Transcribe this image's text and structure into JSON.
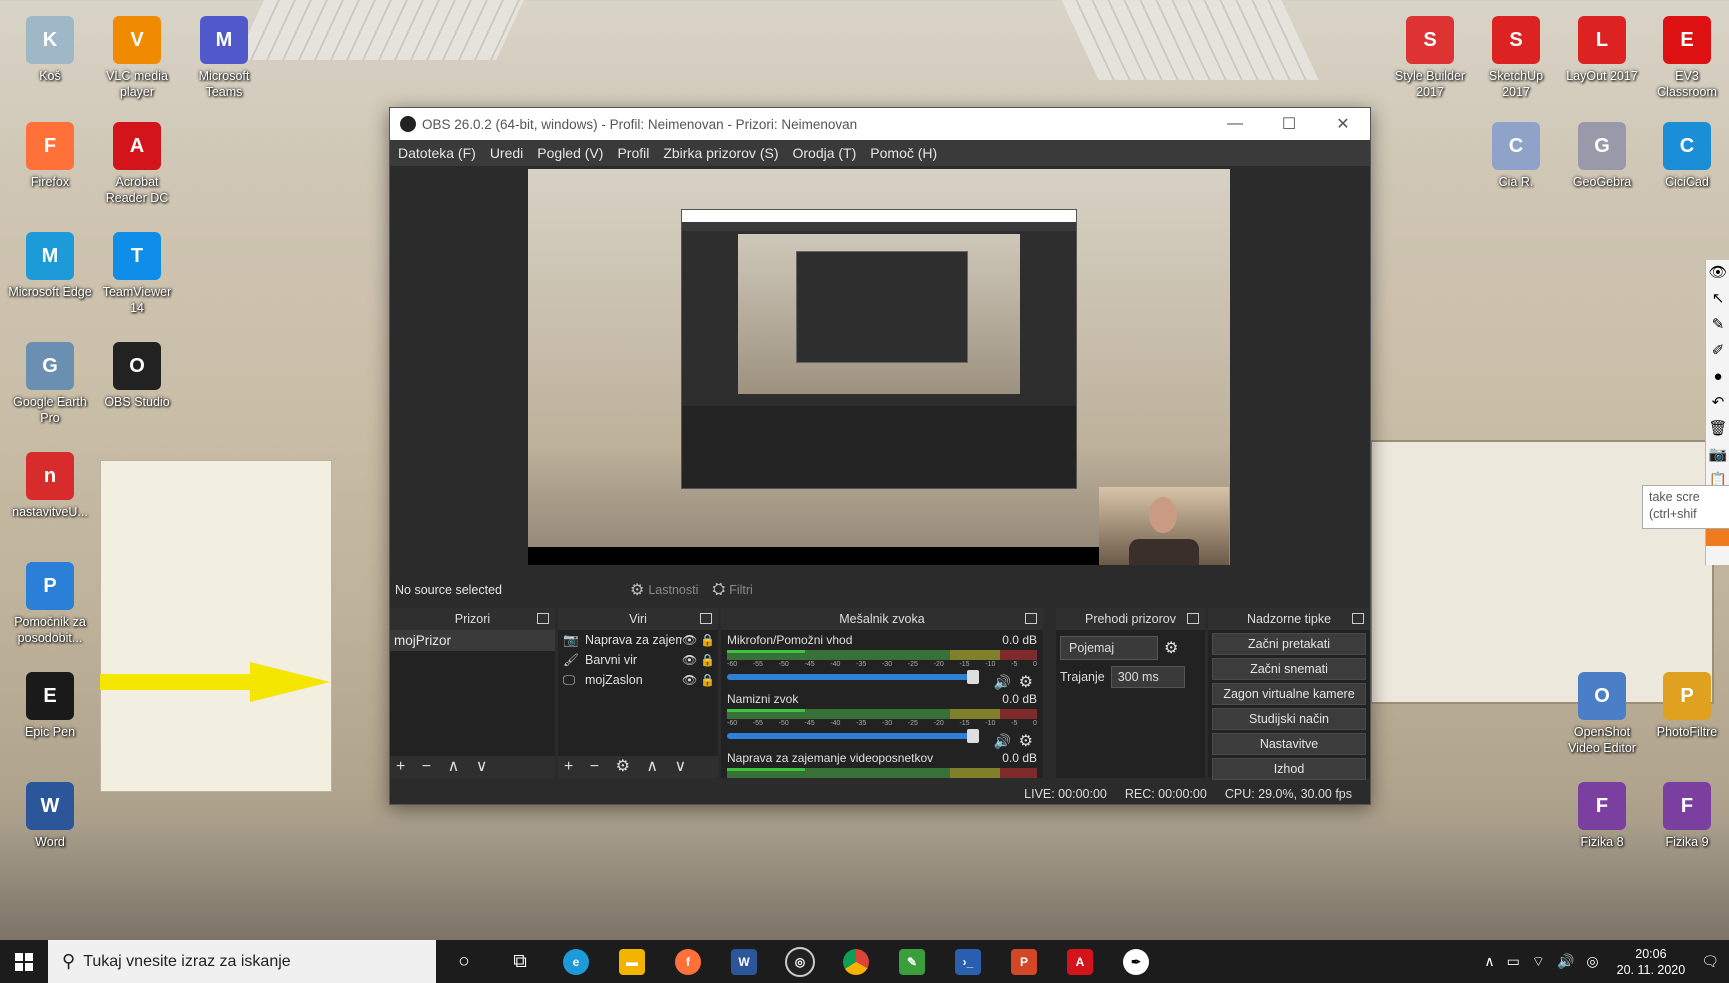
{
  "desktop": {
    "icons_left": [
      {
        "label": "Koš",
        "icon": "recycle-bin-icon",
        "color": "#9fb8c8"
      },
      {
        "label": "VLC media player",
        "icon": "vlc-icon",
        "color": "#f08a00"
      },
      {
        "label": "Microsoft Teams",
        "icon": "teams-icon",
        "color": "#5059c9"
      },
      {
        "label": "Firefox",
        "icon": "firefox-icon",
        "color": "#ff7139"
      },
      {
        "label": "Acrobat Reader DC",
        "icon": "acrobat-icon",
        "color": "#d4141b"
      },
      {
        "label": "Microsoft Edge",
        "icon": "edge-icon",
        "color": "#1c9bd8"
      },
      {
        "label": "TeamViewer 14",
        "icon": "teamviewer-icon",
        "color": "#0e8ee9"
      },
      {
        "label": "Google Earth Pro",
        "icon": "google-earth-icon",
        "color": "#6b8fb0"
      },
      {
        "label": "OBS Studio",
        "icon": "obs-icon",
        "color": "#222222"
      },
      {
        "label": "nastavitveU...",
        "icon": "toolbox-icon",
        "color": "#d82c2c"
      },
      {
        "label": "Pomočnik za posodobit...",
        "icon": "windows-update-icon",
        "color": "#2a7fd6"
      },
      {
        "label": "Epic Pen",
        "icon": "epic-pen-icon",
        "color": "#1a1a1a"
      },
      {
        "label": "Word",
        "icon": "word-icon",
        "color": "#2b579a"
      }
    ],
    "icons_right": [
      {
        "label": "Style Builder 2017",
        "icon": "style-builder-icon",
        "color": "#d33"
      },
      {
        "label": "SketchUp 2017",
        "icon": "sketchup-icon",
        "color": "#d22"
      },
      {
        "label": "LayOut 2017",
        "icon": "layout-icon",
        "color": "#d22"
      },
      {
        "label": "EV3 Classroom",
        "icon": "ev3-icon",
        "color": "#d11"
      },
      {
        "label": "Cia R.",
        "icon": "shell-icon",
        "color": "#8fa3c8"
      },
      {
        "label": "GeoGebra",
        "icon": "geogebra-icon",
        "color": "#99a"
      },
      {
        "label": "CiciCad",
        "icon": "cicicad-icon",
        "color": "#1a8fd8"
      },
      {
        "label": "OpenShot Video Editor",
        "icon": "openshot-icon",
        "color": "#4a7fc8"
      },
      {
        "label": "PhotoFiltre",
        "icon": "photofiltre-icon",
        "color": "#e0a020"
      },
      {
        "label": "Fizika 8",
        "icon": "firefox-doc-icon",
        "color": "#7b3fa0"
      },
      {
        "label": "Fizika 9",
        "icon": "firefox-doc-icon",
        "color": "#7b3fa0"
      }
    ],
    "tooltip": {
      "line1": "take scre",
      "line2": "(ctrl+shif"
    }
  },
  "obs": {
    "title": "OBS 26.0.2 (64-bit, windows) - Profil: Neimenovan - Prizori: Neimenovan",
    "menu": [
      "Datoteka (F)",
      "Uredi",
      "Pogled (V)",
      "Profil",
      "Zbirka prizorov (S)",
      "Orodja (T)",
      "Pomoč (H)"
    ],
    "source_bar": {
      "no_source": "No source selected",
      "properties": "Lastnosti",
      "filters": "Filtri"
    },
    "docks": {
      "scenes": {
        "title": "Prizori",
        "items": [
          "mojPrizor"
        ]
      },
      "sources": {
        "title": "Viri",
        "items": [
          {
            "name": "Naprava za zajem",
            "icon": "camera-icon"
          },
          {
            "name": "Barvni vir",
            "icon": "brush-icon"
          },
          {
            "name": "mojZaslon",
            "icon": "monitor-icon"
          }
        ]
      },
      "mixer": {
        "title": "Mešalnik zvoka",
        "channels": [
          {
            "name": "Mikrofon/Pomožni vhod",
            "db": "0.0 dB"
          },
          {
            "name": "Namizni zvok",
            "db": "0.0 dB"
          },
          {
            "name": "Naprava za zajemanje videoposnetkov",
            "db": "0.0 dB"
          }
        ],
        "scale": [
          "-60",
          "-55",
          "-50",
          "-45",
          "-40",
          "-35",
          "-30",
          "-25",
          "-20",
          "-15",
          "-10",
          "-5",
          "0"
        ]
      },
      "transitions": {
        "title": "Prehodi prizorov",
        "type": "Pojemaj",
        "duration_label": "Trajanje",
        "duration": "300 ms"
      },
      "controls": {
        "title": "Nadzorne tipke",
        "buttons": [
          "Začni pretakati",
          "Začni snemati",
          "Zagon virtualne kamere",
          "Studijski način",
          "Nastavitve",
          "Izhod"
        ]
      }
    },
    "status": {
      "live": "LIVE: 00:00:00",
      "rec": "REC: 00:00:00",
      "cpu": "CPU: 29.0%, 30.00 fps"
    }
  },
  "taskbar": {
    "search_placeholder": "Tukaj vnesite izraz za iskanje",
    "time": "20:06",
    "date": "20. 11. 2020"
  },
  "colors": {
    "obs_bg": "#2b2b2b",
    "taskbar": "#1c1c1c",
    "fader": "#2f7fd8",
    "arrow": "#f5e600"
  }
}
